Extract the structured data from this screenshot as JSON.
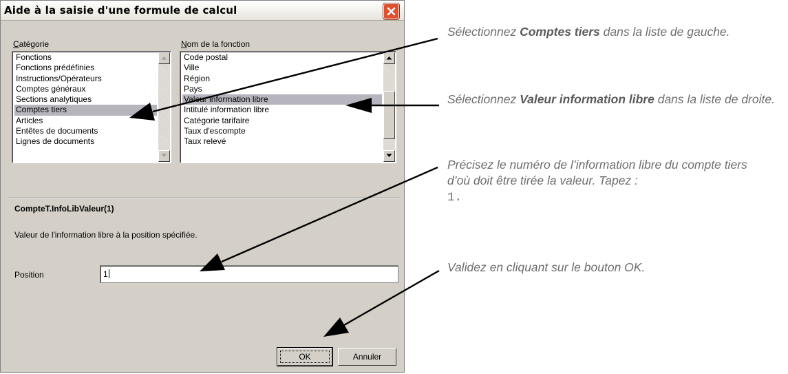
{
  "dialog": {
    "title": "Aide à la saisie d'une formule de calcul",
    "category_label": "Catégorie",
    "function_label": "Nom de la fonction",
    "categories": [
      "Fonctions",
      "Fonctions prédéfinies",
      "Instructions/Opérateurs",
      "Comptes généraux",
      "Sections analytiques",
      "Comptes tiers",
      "Articles",
      "Entêtes de documents",
      "Lignes de documents"
    ],
    "selected_category": "Comptes tiers",
    "functions": [
      "Code postal",
      "Ville",
      "Région",
      "Pays",
      "Valeur information libre",
      "Intitulé information libre",
      "Catégorie tarifaire",
      "Taux d'escompte",
      "Taux relevé"
    ],
    "selected_function": "Valeur information libre",
    "function_signature": "CompteT.InfoLibValeur(1)",
    "function_description": "Valeur de l'information libre à la position spécifiée.",
    "position_label": "Position",
    "position_value": "1",
    "ok_label": "OK",
    "cancel_label": "Annuler"
  },
  "annotations": {
    "a1_pre": "Sélectionnez ",
    "a1_bold": "Comptes tiers",
    "a1_post": " dans la liste de gauche.",
    "a2_pre": "Sélectionnez ",
    "a2_bold": "Valeur information libre",
    "a2_post": " dans la liste de droite.",
    "a3_text": "Précisez le numéro de l’information libre du compte tiers d’où doit être tirée la valeur. Tapez :",
    "a3_code": "1.",
    "a4_text": "Validez en cliquant sur le bouton OK."
  },
  "icons": {
    "close": "close-icon",
    "scroll_up": "arrow-up-icon",
    "scroll_down": "arrow-down-icon"
  },
  "colors": {
    "dialog_bg": "#d4d0c8",
    "selection": "#b6b4bd",
    "close_button": "#e0502f",
    "annotation_text": "#6e6e6e"
  }
}
